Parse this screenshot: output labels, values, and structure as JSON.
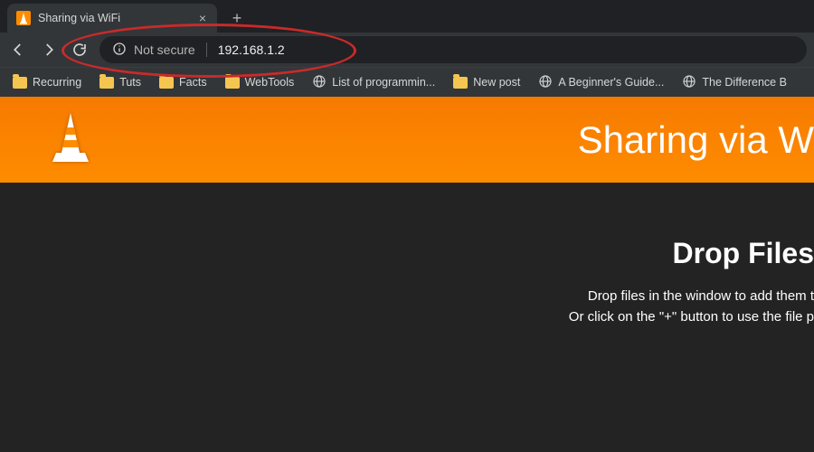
{
  "browser": {
    "tab": {
      "title": "Sharing via WiFi"
    },
    "address": {
      "security_label": "Not secure",
      "url": "192.168.1.2"
    },
    "bookmarks": [
      {
        "type": "folder",
        "label": "Recurring"
      },
      {
        "type": "folder",
        "label": "Tuts"
      },
      {
        "type": "folder",
        "label": "Facts"
      },
      {
        "type": "folder",
        "label": "WebTools"
      },
      {
        "type": "link",
        "label": "List of programmin..."
      },
      {
        "type": "folder",
        "label": "New post"
      },
      {
        "type": "link",
        "label": "A Beginner's Guide..."
      },
      {
        "type": "link",
        "label": "The Difference B"
      }
    ]
  },
  "page": {
    "header_title": "Sharing via W",
    "drop_heading": "Drop Files",
    "drop_line1": "Drop files in the window to add them t",
    "drop_line2": "Or click on the \"+\" button to use the file p"
  }
}
